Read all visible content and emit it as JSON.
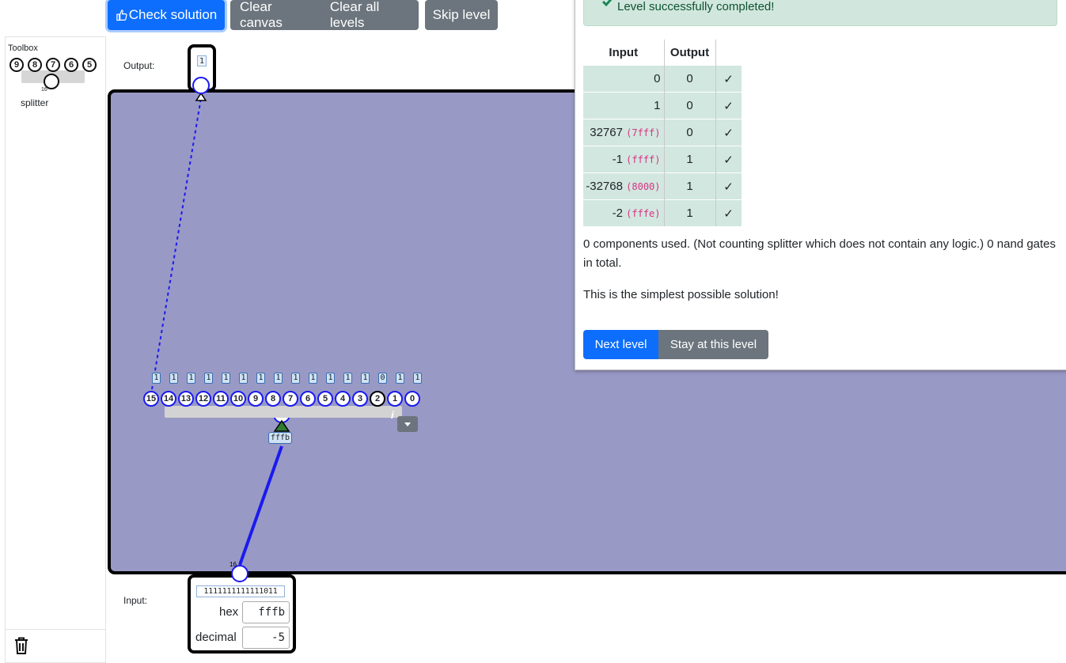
{
  "toolbar": {
    "check_label": "Check solution",
    "clear_canvas_label": "Clear canvas",
    "clear_all_label": "Clear all levels",
    "skip_label": "Skip level"
  },
  "toolbox": {
    "title": "Toolbox",
    "item_label": "splitter",
    "item_pins": [
      "9",
      "8",
      "7",
      "6",
      "5"
    ],
    "item_width": "16"
  },
  "canvas": {
    "output_label": "Output:",
    "input_label": "Input:",
    "output_value": "1",
    "input_bits": "1111111111111011",
    "hex_label": "hex",
    "hex_value": "fffb",
    "decimal_label": "decimal",
    "decimal_value": "-5",
    "wire_width_label": "16",
    "splitter": {
      "bit_values": [
        "1",
        "1",
        "1",
        "1",
        "1",
        "1",
        "1",
        "1",
        "1",
        "1",
        "1",
        "1",
        "1",
        "0",
        "1",
        "1"
      ],
      "bit_indices": [
        "15",
        "14",
        "13",
        "12",
        "11",
        "10",
        "9",
        "8",
        "7",
        "6",
        "5",
        "4",
        "3",
        "2",
        "1",
        "0"
      ],
      "hex_value": "fffb",
      "info_icon": "i"
    }
  },
  "result": {
    "alert_text": "Level successfully completed!",
    "table_headers": [
      "Input",
      "Output",
      ""
    ],
    "rows": [
      {
        "input": "0",
        "hex": "",
        "output": "0",
        "mark": "✓"
      },
      {
        "input": "1",
        "hex": "",
        "output": "0",
        "mark": "✓"
      },
      {
        "input": "32767",
        "hex": "(7fff)",
        "output": "0",
        "mark": "✓"
      },
      {
        "input": "-1",
        "hex": "(ffff)",
        "output": "1",
        "mark": "✓"
      },
      {
        "input": "-32768",
        "hex": "(8000)",
        "output": "1",
        "mark": "✓"
      },
      {
        "input": "-2",
        "hex": "(fffe)",
        "output": "1",
        "mark": "✓"
      }
    ],
    "summary": "0 components used. (Not counting splitter which does not contain any logic.) 0 nand gates in total.",
    "simplest": "This is the simplest possible solution!",
    "next_label": "Next level",
    "stay_label": "Stay at this level"
  },
  "colors": {
    "primary": "#0d6efd",
    "secondary": "#6c757d",
    "board": "#9999c6",
    "success_bg": "#d1e7dd",
    "wire": "#0000ee"
  }
}
